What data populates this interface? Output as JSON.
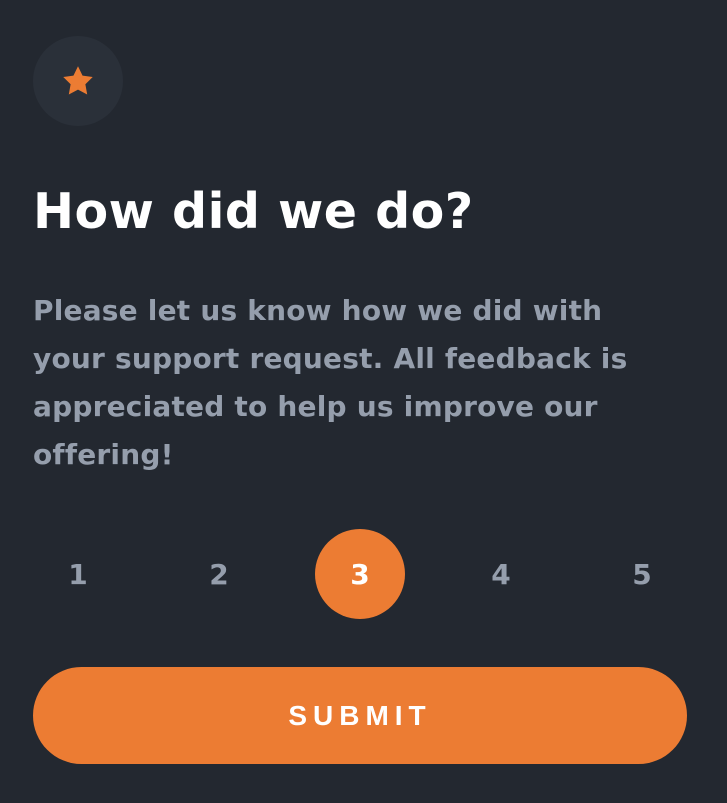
{
  "icon": "star-icon",
  "title": "How did we do?",
  "description": "Please let us know how we did with your support request. All feedback is appreciated to help us improve our offering!",
  "ratings": [
    "1",
    "2",
    "3",
    "4",
    "5"
  ],
  "selected_rating": "3",
  "submit_label": "SUBMIT",
  "colors": {
    "background": "#232830",
    "icon_circle": "#2a3039",
    "accent": "#ec7c33",
    "muted_text": "#959eac",
    "title_text": "#ffffff"
  }
}
